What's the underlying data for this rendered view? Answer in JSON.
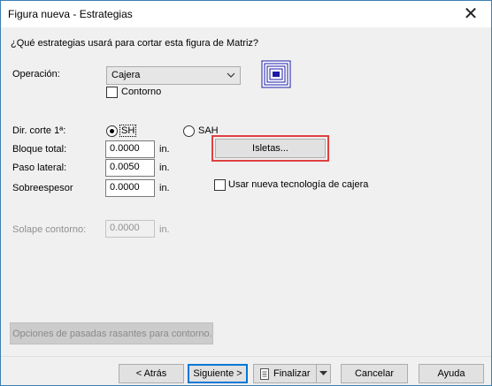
{
  "window": {
    "title": "Figura nueva - Estrategias",
    "close_glyph": "✕"
  },
  "question": "¿Qué estrategias usará para cortar esta figura de Matriz?",
  "operation": {
    "label": "Operación:",
    "selected": "Cajera"
  },
  "contorno": {
    "label": "Contorno",
    "checked": false
  },
  "direction": {
    "label": "Dir. corte 1ª:",
    "sh_label": "SH",
    "sah_label": "SAH",
    "selected": "SH"
  },
  "bloque_total": {
    "label": "Bloque total:",
    "value": "0.0000",
    "unit": "in."
  },
  "paso_lateral": {
    "label": "Paso lateral:",
    "value": "0.0050",
    "unit": "in."
  },
  "sobreespesor": {
    "label": "Sobreespesor",
    "value": "0.0000",
    "unit": "in."
  },
  "solape": {
    "label": "Solape contorno:",
    "value": "0.0000",
    "unit": "in."
  },
  "isletas_button": "Isletas...",
  "nueva_tecnologia": {
    "label": "Usar nueva tecnología de cajera",
    "checked": false
  },
  "opciones_button": "Opciones de pasadas rasantes para contorno..",
  "footer": {
    "back": "< Atrás",
    "next": "Siguiente >",
    "finish": "Finalizar",
    "cancel": "Cancelar",
    "help": "Ayuda"
  },
  "colors": {
    "highlight": "#e04040",
    "accent": "#0078d7",
    "pocket_icon": "#1a1aa8"
  }
}
